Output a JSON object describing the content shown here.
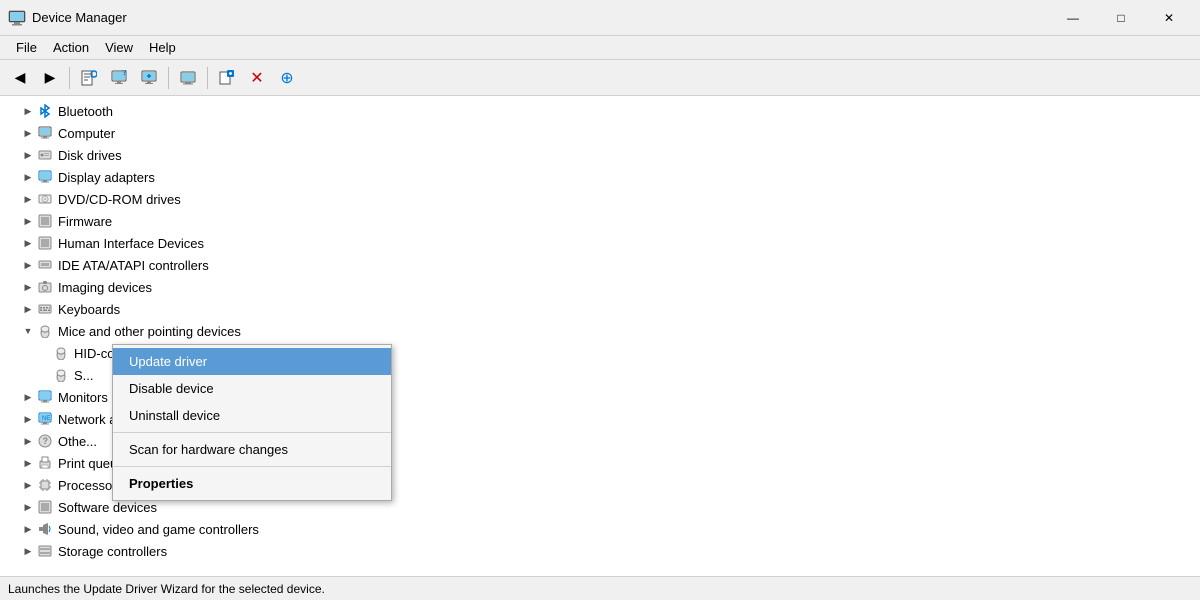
{
  "window": {
    "title": "Device Manager",
    "icon": "🖥"
  },
  "title_controls": {
    "minimize": "—",
    "maximize": "□",
    "close": "✕"
  },
  "menu": {
    "items": [
      "File",
      "Action",
      "View",
      "Help"
    ]
  },
  "toolbar": {
    "buttons": [
      "◀",
      "▶",
      "⬛",
      "⬛",
      "❓",
      "⬛",
      "🖥",
      "❌",
      "⬇"
    ]
  },
  "tree": {
    "items": [
      {
        "id": "bluetooth",
        "label": "Bluetooth",
        "icon": "🔵",
        "level": 1,
        "toggle": "▶",
        "expanded": false
      },
      {
        "id": "computer",
        "label": "Computer",
        "icon": "🖥",
        "level": 1,
        "toggle": "▶",
        "expanded": false
      },
      {
        "id": "disk",
        "label": "Disk drives",
        "icon": "💽",
        "level": 1,
        "toggle": "▶",
        "expanded": false
      },
      {
        "id": "display",
        "label": "Display adapters",
        "icon": "🖵",
        "level": 1,
        "toggle": "▶",
        "expanded": false
      },
      {
        "id": "dvd",
        "label": "DVD/CD-ROM drives",
        "icon": "💿",
        "level": 1,
        "toggle": "▶",
        "expanded": false
      },
      {
        "id": "firmware",
        "label": "Firmware",
        "icon": "▦",
        "level": 1,
        "toggle": "▶",
        "expanded": false
      },
      {
        "id": "hid",
        "label": "Human Interface Devices",
        "icon": "▦",
        "level": 1,
        "toggle": "▶",
        "expanded": false
      },
      {
        "id": "ide",
        "label": "IDE ATA/ATAPI controllers",
        "icon": "▦",
        "level": 1,
        "toggle": "▶",
        "expanded": false
      },
      {
        "id": "imaging",
        "label": "Imaging devices",
        "icon": "📷",
        "level": 1,
        "toggle": "▶",
        "expanded": false
      },
      {
        "id": "keyboards",
        "label": "Keyboards",
        "icon": "⌨",
        "level": 1,
        "toggle": "▶",
        "expanded": false
      },
      {
        "id": "mice",
        "label": "Mice and other pointing devices",
        "icon": "🖱",
        "level": 1,
        "toggle": "▼",
        "expanded": true
      },
      {
        "id": "hid-mouse",
        "label": "HID-compliant mouse",
        "icon": "🖱",
        "level": 2,
        "toggle": "",
        "expanded": false
      },
      {
        "id": "synaptics",
        "label": "S...",
        "icon": "🖱",
        "level": 2,
        "toggle": "",
        "expanded": false
      },
      {
        "id": "monitors",
        "label": "Monitors",
        "icon": "🖵",
        "level": 1,
        "toggle": "▶",
        "expanded": false
      },
      {
        "id": "network",
        "label": "Network adapters",
        "icon": "🌐",
        "level": 1,
        "toggle": "▶",
        "expanded": false
      },
      {
        "id": "other",
        "label": "Othe...",
        "icon": "❓",
        "level": 1,
        "toggle": "▶",
        "expanded": false
      },
      {
        "id": "print",
        "label": "Print queues",
        "icon": "🖨",
        "level": 1,
        "toggle": "▶",
        "expanded": false
      },
      {
        "id": "proc",
        "label": "Processors",
        "icon": "▦",
        "level": 1,
        "toggle": "▶",
        "expanded": false
      },
      {
        "id": "soft",
        "label": "Software devices",
        "icon": "▦",
        "level": 1,
        "toggle": "▶",
        "expanded": false
      },
      {
        "id": "sound",
        "label": "Sound, video and game controllers",
        "icon": "🔊",
        "level": 1,
        "toggle": "▶",
        "expanded": false
      },
      {
        "id": "storage",
        "label": "Storage controllers",
        "icon": "💾",
        "level": 1,
        "toggle": "▶",
        "expanded": false
      }
    ]
  },
  "context_menu": {
    "items": [
      {
        "id": "update",
        "label": "Update driver",
        "highlighted": true,
        "bold": false,
        "separator_after": false
      },
      {
        "id": "disable",
        "label": "Disable device",
        "highlighted": false,
        "bold": false,
        "separator_after": false
      },
      {
        "id": "uninstall",
        "label": "Uninstall device",
        "highlighted": false,
        "bold": false,
        "separator_after": true
      },
      {
        "id": "scan",
        "label": "Scan for hardware changes",
        "highlighted": false,
        "bold": false,
        "separator_after": true
      },
      {
        "id": "properties",
        "label": "Properties",
        "highlighted": false,
        "bold": true,
        "separator_after": false
      }
    ]
  },
  "status_bar": {
    "text": "Launches the Update Driver Wizard for the selected device."
  }
}
